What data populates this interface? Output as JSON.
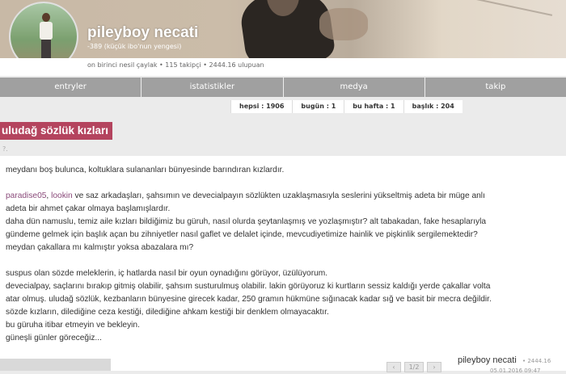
{
  "profile": {
    "username": "pileyboy necati",
    "subtitle": "-389 (küçük ibo'nun yengesi)",
    "stats_line": "on birinci nesil çaylak • 115 takipçi • 2444.16 ulupuan"
  },
  "nav": {
    "items": [
      "entryler",
      "istatistikler",
      "medya",
      "takip"
    ]
  },
  "counts": {
    "all": "hepsi : 1906",
    "today": "bugün : 1",
    "week": "bu hafta : 1",
    "titles": "başlık : 204"
  },
  "topic": {
    "title": "uludağ sözlük kızları",
    "question": "?."
  },
  "entry": {
    "line1": "meydanı boş bulunca, koltuklara sulananları bünyesinde barındıran kızlardır.",
    "mention1": "paradise05",
    "mention_sep": ", ",
    "mention2": "lookin",
    "line2_rest": " ve saz arkadaşları, şahsımın ve devecialpayın sözlükten uzaklaşmasıyla seslerini yükseltmiş adeta bir müge anlı",
    "line3": "adeta bir ahmet çakar olmaya başlamışlardır.",
    "line4": "daha dün namuslu, temiz aile kızları bildiğimiz bu güruh, nasıl olurda şeytanlaşmış ve yozlaşmıştır? alt tabakadan, fake hesaplarıyla",
    "line5": "gündeme gelmek için başlık açan bu zihniyetler nasıl gaflet ve delalet içinde, mevcudiyetimize hainlik ve pişkinlik sergilemektedir?",
    "line6": "meydan çakallara mı kalmıştır yoksa abazalara mı?",
    "line7": "suspus olan sözde meleklerin, iç hatlarda nasıl bir oyun oynadığını görüyor, üzülüyorum.",
    "line8": "devecialpay, saçlarını bırakıp gitmiş olabilir, şahsım susturulmuş olabilir. lakin görüyoruz ki kurtların sessiz kaldığı yerde çakallar volta",
    "line9": "atar olmuş. uludağ sözlük, kezbanların bünyesine girecek kadar, 250 gramın hükmüne sığınacak kadar sığ ve basit bir mecra değildir.",
    "line10": "sözde kızların, dilediğine ceza kestiği, dilediğine ahkam kestiği bir denklem olmayacaktır.",
    "line11": "bu güruha itibar etmeyin ve bekleyin.",
    "line12": "güneşli günler göreceğiz...",
    "author": "pileyboy necati",
    "author_score": "• 2444.16",
    "date": "05.01.2016 09:47"
  },
  "pager": {
    "prev": "‹",
    "current": "1/2",
    "next": "›"
  }
}
